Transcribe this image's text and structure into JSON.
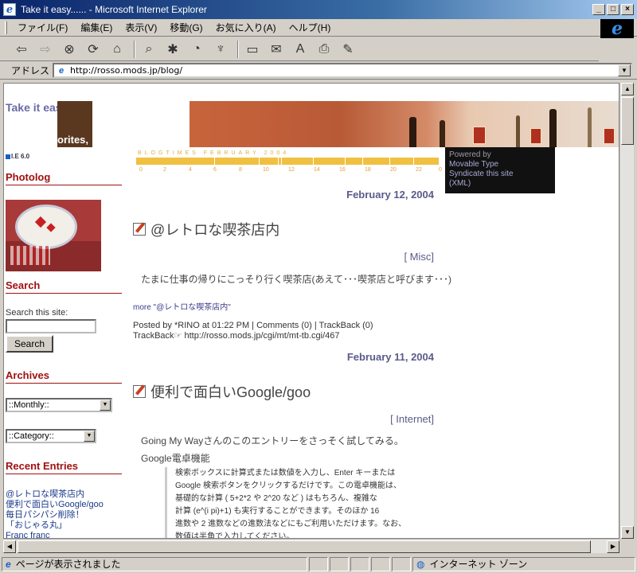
{
  "window": {
    "title": "Take it easy...... - Microsoft Internet Explorer",
    "app_icon": "e",
    "brand_icon": "e"
  },
  "menu": [
    "ファイル(F)",
    "編集(E)",
    "表示(V)",
    "移動(G)",
    "お気に入り(A)",
    "ヘルプ(H)"
  ],
  "toolbar": {
    "buttons": [
      "back-icon",
      "forward-icon",
      "stop-icon",
      "refresh-icon",
      "home-icon",
      "search-icon",
      "favorites-icon",
      "history-icon",
      "channels-icon",
      "fullscreen-icon",
      "mail-icon",
      "font-icon",
      "print-icon",
      "edit-icon"
    ]
  },
  "address": {
    "label": "アドレス",
    "url": "http://rosso.mods.jp/blog/"
  },
  "status": {
    "text": "ページが表示されました",
    "zone": "インターネット ゾーン"
  },
  "sidebar": {
    "site_title": "Take it easy......",
    "fav_text": "orites,",
    "ie_badge": "I.E 6.0",
    "photolog_heading": "Photolog",
    "search_heading": "Search",
    "search_label": "Search this site:",
    "search_button": "Search",
    "archives_heading": "Archives",
    "monthly_select": "::Monthly::",
    "category_select": "::Category::",
    "recent_heading": "Recent Entries",
    "recent_entries": [
      "@レトロな喫茶店内",
      "便利で面白いGoogle/goo",
      "毎日パシパシ削除！",
      "「おじゃる丸」",
      "Franc franc"
    ]
  },
  "blogtimes": {
    "title": "BLOGTIMES  FEBRUARY 2004",
    "ticks": [
      "0",
      "2",
      "4",
      "6",
      "8",
      "10",
      "12",
      "14",
      "16",
      "18",
      "20",
      "22",
      "0"
    ]
  },
  "powered": {
    "line1": "Powered by",
    "line2": "Movable Type",
    "line3": "Syndicate this site",
    "line4": "(XML)"
  },
  "entries": [
    {
      "date": "February 12, 2004",
      "title": "@レトロな喫茶店内",
      "category": "[ Misc]",
      "body": "たまに仕事の帰りにこっそり行く喫茶店(あえて･･･喫茶店と呼びます･･･)",
      "more": "more \"@レトロな喫茶店内\"",
      "posted": "Posted by *RINO at 01:22 PM | Comments (0) | TrackBack (0)",
      "trackback": "TrackBack☞ http://rosso.mods.jp/cgi/mt/mt-tb.cgi/467"
    },
    {
      "date": "February 11, 2004",
      "title": "便利で面白いGoogle/goo",
      "category": "[ Internet]",
      "body1": "Going My Wayさんのこのエントリーをさっそく試してみる。",
      "body2": "Google電卓機能",
      "quote": [
        "検索ボックスに計算式または数値を入力し、Enter キーまたは",
        "Google 検索ボタンをクリックするだけです。この電卓機能は、",
        "基礎的な計算 ( 5+2*2 や 2^20 など ) はもちろん、複雑な",
        "計算 (e^(i pi)+1) も実行することができます。そのほか 16",
        "進数や 2 進数などの進数法などにもご利用いただけます。なお、",
        "数値は半角で入力してください。"
      ]
    }
  ]
}
